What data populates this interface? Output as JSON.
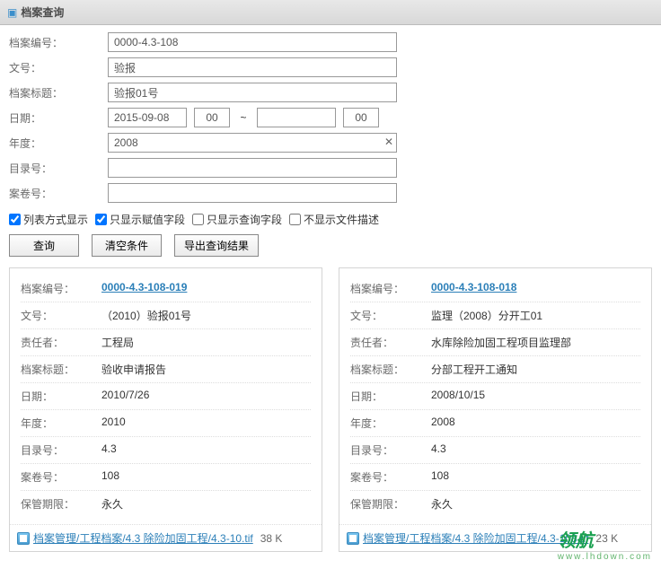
{
  "header": {
    "title": "档案查询"
  },
  "form": {
    "labels": {
      "archive_no": "档案编号：",
      "doc_no": "文号：",
      "title": "档案标题：",
      "date": "日期：",
      "year": "年度：",
      "catalog": "目录号：",
      "volume": "案卷号："
    },
    "values": {
      "archive_no": "0000-4.3-108",
      "doc_no": "验报",
      "title": "验报01号",
      "date_from": "2015-09-08",
      "time_from": "00",
      "tilde": "~",
      "date_to": "",
      "time_to": "00",
      "year": "2008",
      "catalog": "",
      "volume": ""
    }
  },
  "checkboxes": {
    "c1": {
      "label": "列表方式显示",
      "checked": true
    },
    "c2": {
      "label": "只显示赋值字段",
      "checked": true
    },
    "c3": {
      "label": "只显示查询字段",
      "checked": false
    },
    "c4": {
      "label": "不显示文件描述",
      "checked": false
    }
  },
  "buttons": {
    "query": "查询",
    "clear": "清空条件",
    "export": "导出查询结果"
  },
  "result_labels": {
    "archive_no": "档案编号：",
    "doc_no": "文号：",
    "resp": "责任者：",
    "title": "档案标题：",
    "date": "日期：",
    "year": "年度：",
    "catalog": "目录号：",
    "volume": "案卷号：",
    "retention": "保管期限："
  },
  "results": [
    {
      "archive_no": "0000-4.3-108-019",
      "doc_no": "（2010）验报01号",
      "resp": "工程局",
      "title": "验收申请报告",
      "date": "2010/7/26",
      "year": "2010",
      "catalog": "4.3",
      "volume": "108",
      "retention": "永久",
      "attach": {
        "name": "档案管理/工程档案/4.3 除险加固工程/4.3-10.tif",
        "size": "38 K"
      }
    },
    {
      "archive_no": "0000-4.3-108-018",
      "doc_no": "监理（2008）分开工01",
      "resp": "水库除险加固工程项目监理部",
      "title": "分部工程开工通知",
      "date": "2008/10/15",
      "year": "2008",
      "catalog": "4.3",
      "volume": "108",
      "retention": "永久",
      "attach": {
        "name": "档案管理/工程档案/4.3 除险加固工程/4.3-108.tif",
        "size": "23 K"
      }
    }
  ],
  "watermark": {
    "main": "领航",
    "sub": "www.lhdown.com"
  }
}
